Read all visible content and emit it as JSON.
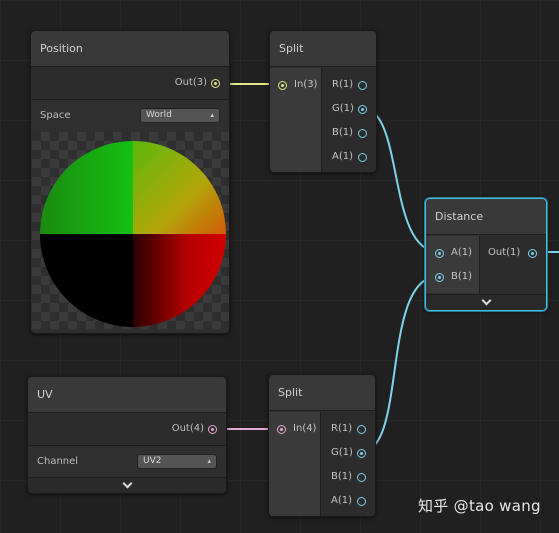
{
  "colors": {
    "background": "#202020",
    "wire_blue": "#7ed2ea",
    "wire_yellow": "#e2e68a",
    "wire_pink": "#e6a8d7",
    "selection": "#44c0e4"
  },
  "nodes": {
    "position": {
      "title": "Position",
      "output": "Out(3)",
      "space_label": "Space",
      "space_value": "World"
    },
    "split_top": {
      "title": "Split",
      "input": "In(3)",
      "outputs": [
        "R(1)",
        "G(1)",
        "B(1)",
        "A(1)"
      ]
    },
    "distance": {
      "title": "Distance",
      "inputs": [
        "A(1)",
        "B(1)"
      ],
      "output": "Out(1)"
    },
    "uv": {
      "title": "UV",
      "output": "Out(4)",
      "channel_label": "Channel",
      "channel_value": "UV2"
    },
    "split_bottom": {
      "title": "Split",
      "input": "In(4)",
      "outputs": [
        "R(1)",
        "G(1)",
        "B(1)",
        "A(1)"
      ]
    }
  },
  "icons": {
    "dropdown_arrow": "updown-arrow-icon",
    "collapse": "chevron-down-icon"
  },
  "watermark": "知乎 @tao wang"
}
